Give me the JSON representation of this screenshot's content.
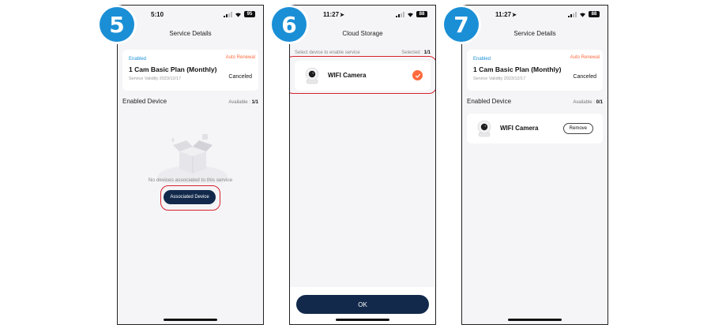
{
  "steps": [
    {
      "number": "5",
      "status_bar": {
        "time": "5:10",
        "battery": "95"
      },
      "title": "Service Details",
      "plan": {
        "enabled_tag": "Enabled",
        "auto_renewal": "Auto Renewal",
        "name": "1 Cam Basic Plan (Monthly)",
        "validity": "Service Validity 2023/12/17",
        "status": "Canceled"
      },
      "section": {
        "title": "Enabled Device",
        "available_label": "Available :",
        "available_value": "1/1"
      },
      "empty_text": "No devices associated to this service",
      "associate_button": "Associated Device"
    },
    {
      "number": "6",
      "status_bar": {
        "time": "11:27",
        "battery": "88"
      },
      "title": "Cloud Storage",
      "select_hint": "Select device to enable service",
      "selected_label": "Selected :",
      "selected_value": "1/1",
      "device": {
        "name": "WIFI Camera",
        "selected": true
      },
      "ok_button": "OK"
    },
    {
      "number": "7",
      "status_bar": {
        "time": "11:27",
        "battery": "88"
      },
      "title": "Service Details",
      "plan": {
        "enabled_tag": "Enabled",
        "auto_renewal": "Auto Renewal",
        "name": "1 Cam Basic Plan (Monthly)",
        "validity": "Service Validity 2023/12/17",
        "status": "Canceled"
      },
      "section": {
        "title": "Enabled Device",
        "available_label": "Available :",
        "available_value": "0/1"
      },
      "device": {
        "name": "WIFI Camera"
      },
      "remove_button": "Remove"
    }
  ],
  "colors": {
    "step_badge": "#1a8fd6",
    "primary_button": "#12294b",
    "accent_orange": "#ff6a3d",
    "highlight_red": "#d9212d",
    "enabled_blue": "#1a8fd6"
  },
  "icons": {
    "status": [
      "signal-icon",
      "wifi-icon",
      "battery-icon",
      "location-arrow-icon"
    ],
    "device": "camera-icon",
    "selected": "check-circle-icon",
    "empty": "empty-box-icon"
  }
}
